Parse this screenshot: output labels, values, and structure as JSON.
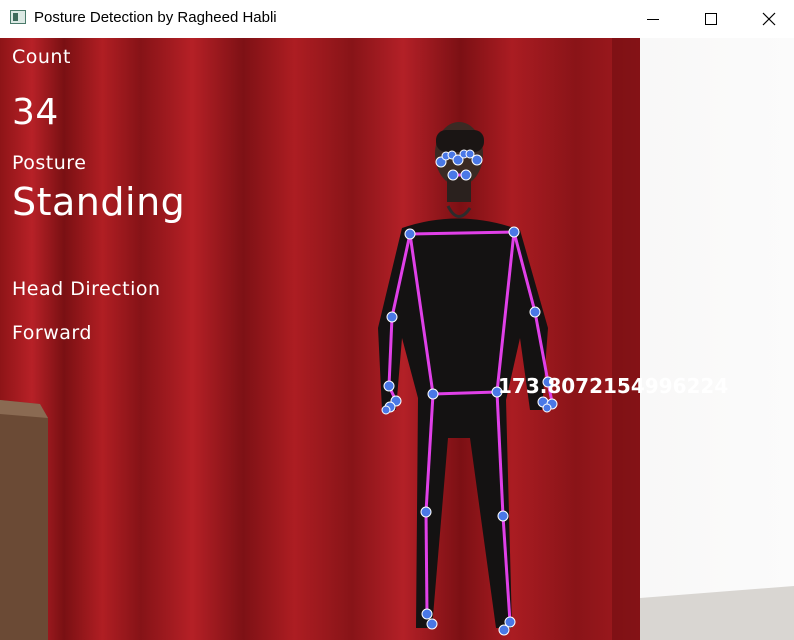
{
  "window": {
    "title": "Posture Detection by Ragheed Habli",
    "controls": {
      "minimize_icon": "minimize-icon",
      "maximize_icon": "maximize-icon",
      "close_icon": "close-icon"
    }
  },
  "overlay": {
    "count_label": "Count",
    "count_value": "34",
    "posture_label": "Posture",
    "posture_value": "Standing",
    "head_direction_label": "Head Direction",
    "head_direction_value": "Forward",
    "angle_value": "173.8072154996224"
  },
  "colors": {
    "skeleton_line": "#e040e8",
    "landmark_point": "#4a78e6",
    "overlay_text": "#ffffff",
    "curtain": "#a51a1f",
    "wall": "#f2f1f0"
  }
}
